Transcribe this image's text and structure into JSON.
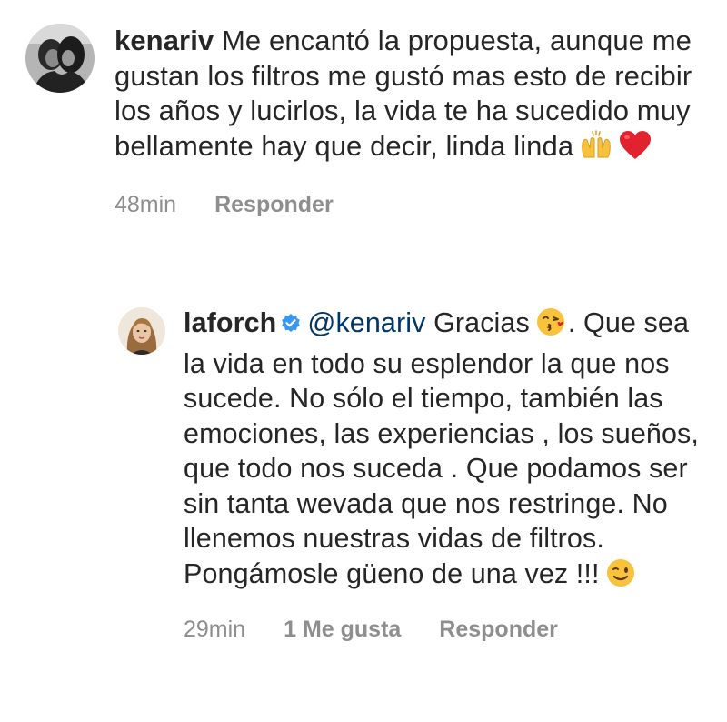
{
  "comments": [
    {
      "username": "kenariv",
      "verified": false,
      "mention": "",
      "text": "Me encantó la propuesta, aunque me gustan los filtros me gustó mas esto de recibir los años y lucirlos, la vida te ha sucedido muy bellamente hay que decir, linda linda",
      "trailing_emojis": [
        "raising-hands-icon",
        "red-heart-icon"
      ],
      "time": "48min",
      "likes": "",
      "reply_label": "Responder"
    },
    {
      "username": "laforch",
      "verified": true,
      "mention": "@kenariv",
      "text_before": "Gracias",
      "text_after": ". Que sea la vida en todo su esplendor la que nos sucede. No sólo el tiempo, también las emociones, las experiencias , los sueños, que todo nos suceda . Que podamos ser sin tanta wevada que nos restringe. No llenemos nuestras vidas de filtros. Pongámosle güeno de una vez !!!",
      "inline_emoji": "kissing-face-icon",
      "trailing_emojis": [
        "winking-face-icon"
      ],
      "time": "29min",
      "likes": "1 Me gusta",
      "reply_label": "Responder"
    }
  ],
  "colors": {
    "text": "#262626",
    "meta": "#8e8e8e",
    "mention": "#00376b",
    "verified": "#3897f0",
    "heart": "#e0232e",
    "emoji_yellow": "#f9c23c"
  }
}
